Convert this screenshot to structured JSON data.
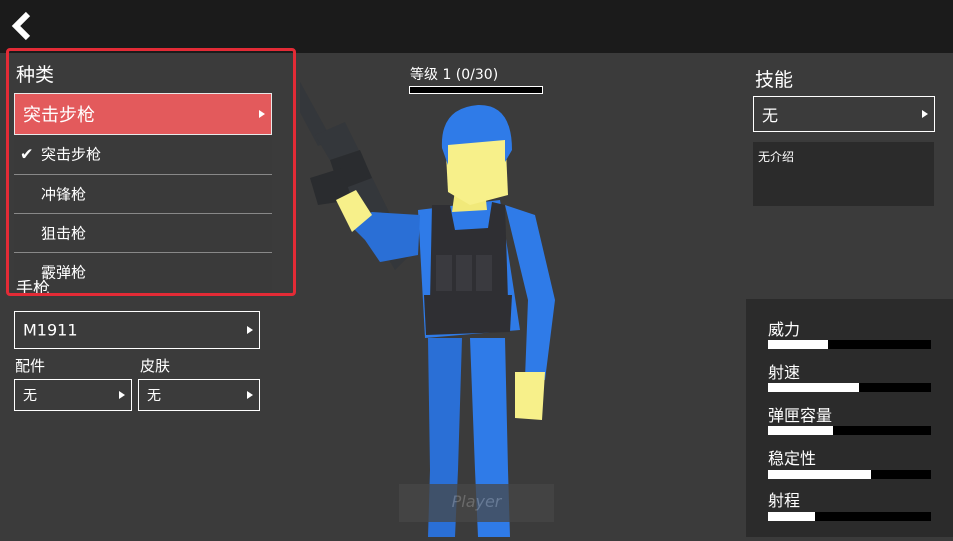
{
  "back_button": {
    "icon": "chevron-left-icon"
  },
  "level": {
    "label": "等级 1 (0/30)",
    "current": 0,
    "max": 30
  },
  "category": {
    "title": "种类",
    "selected": "突击步枪",
    "selected_color": "#e35a5c",
    "options": [
      {
        "label": "突击步枪",
        "checked": true
      },
      {
        "label": "冲锋枪",
        "checked": false
      },
      {
        "label": "狙击枪",
        "checked": false
      },
      {
        "label": "霰弹枪",
        "checked": false
      }
    ],
    "highlight_color": "#e32b36"
  },
  "sidearm": {
    "title_partial": "手枪",
    "selected": "M1911"
  },
  "attachment": {
    "title": "配件",
    "selected": "无"
  },
  "skin": {
    "title": "皮肤",
    "selected": "无"
  },
  "skill": {
    "title": "技能",
    "selected": "无",
    "description": "无介绍"
  },
  "stats": [
    {
      "label": "威力",
      "value": 0.37
    },
    {
      "label": "射速",
      "value": 0.56
    },
    {
      "label": "弹匣容量",
      "value": 0.4
    },
    {
      "label": "稳定性",
      "value": 0.63
    },
    {
      "label": "射程",
      "value": 0.29
    }
  ],
  "player_name": {
    "placeholder": "Player"
  },
  "soldier_colors": {
    "body": "#2f7be8",
    "head": "#f7f08a",
    "vest": "#2f2f33",
    "rifle": "#34373b"
  }
}
